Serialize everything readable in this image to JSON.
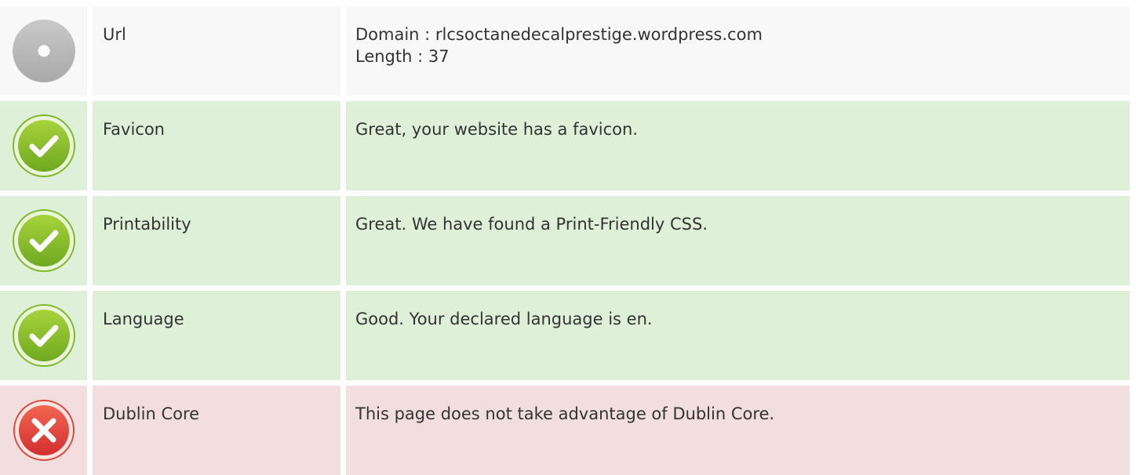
{
  "rows": [
    {
      "status": "neutral",
      "icon": "info-circle-icon",
      "label": "Url",
      "lines": [
        "Domain : rlcsoctanedecalprestige.wordpress.com",
        "Length : 37"
      ]
    },
    {
      "status": "pass",
      "icon": "checkmark-icon",
      "label": "Favicon",
      "lines": [
        "Great, your website has a favicon."
      ]
    },
    {
      "status": "pass",
      "icon": "checkmark-icon",
      "label": "Printability",
      "lines": [
        "Great. We have found a Print-Friendly CSS."
      ]
    },
    {
      "status": "pass",
      "icon": "checkmark-icon",
      "label": "Language",
      "lines": [
        "Good. Your declared language is en."
      ]
    },
    {
      "status": "fail",
      "icon": "cross-icon",
      "label": "Dublin Core",
      "lines": [
        "This page does not take advantage of Dublin Core."
      ]
    }
  ],
  "colors": {
    "neutral_bg": "#f8f8f8",
    "pass_bg": "#dff0d8",
    "fail_bg": "#f2dede",
    "pass_icon": "#8cc63f",
    "fail_icon": "#e53935",
    "neutral_icon": "#bbbbbb"
  }
}
